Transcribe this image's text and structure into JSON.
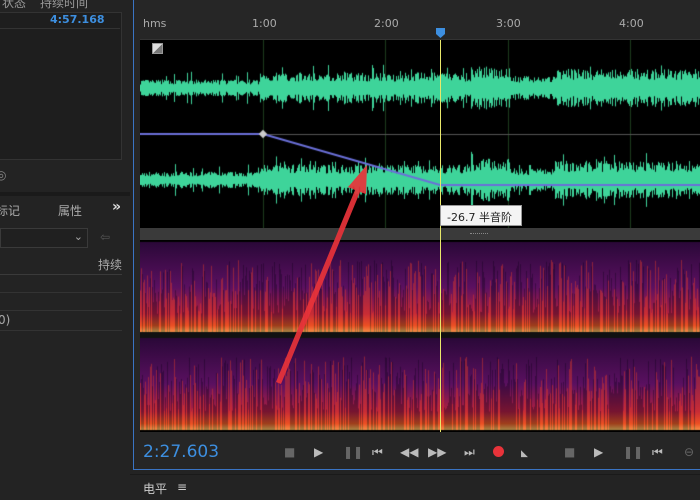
{
  "files_panel": {
    "col_status": "状态",
    "col_duration": "持续时间",
    "duration_value": "4:57.168"
  },
  "markers_panel": {
    "tab_markers": "标记",
    "tab_properties": "属性",
    "more": "»",
    "col_duration": "持续",
    "row_text": "0)"
  },
  "ruler": {
    "unit": "hms",
    "ticks": [
      "1:00",
      "2:00",
      "3:00",
      "4:00"
    ]
  },
  "editor": {
    "pitch_tooltip": "-26.7 半音阶",
    "current_time": "2:27.603",
    "waveform_color": "#3ed49a",
    "envelope_color": "#6a6fd8",
    "playhead_color": "#e8e86a"
  },
  "transport": {
    "buttons": [
      "stop",
      "play",
      "pause",
      "go-to-start",
      "rewind",
      "fast-forward",
      "go-to-end",
      "record",
      "skip",
      "stop-2",
      "play-2",
      "pause-2",
      "go-to-previous",
      "zoom"
    ]
  },
  "levels_panel": {
    "title": "电平",
    "menu": "≡"
  }
}
